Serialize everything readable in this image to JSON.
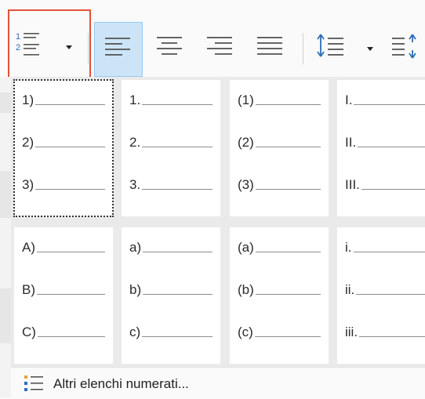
{
  "toolbar": {
    "buttons": [
      {
        "name": "numbering-button",
        "state": "highlighted"
      },
      {
        "name": "align-left-button",
        "state": "active"
      },
      {
        "name": "align-center-button"
      },
      {
        "name": "align-right-button"
      },
      {
        "name": "justify-button"
      },
      {
        "name": "line-spacing-button"
      },
      {
        "name": "paragraph-spacing-button"
      }
    ],
    "highlight_color": "#e0533a",
    "active_color": "#cce4f7"
  },
  "gallery": {
    "tiles": [
      {
        "id": "numbers-paren",
        "markers": [
          "1)",
          "2)",
          "3)"
        ],
        "selected": true
      },
      {
        "id": "numbers-dot",
        "markers": [
          "1.",
          "2.",
          "3."
        ]
      },
      {
        "id": "numbers-both-paren",
        "markers": [
          "(1)",
          "(2)",
          "(3)"
        ]
      },
      {
        "id": "roman-upper-dot",
        "markers": [
          "I.",
          "II.",
          "III."
        ]
      },
      {
        "id": "letters-upper-paren",
        "markers": [
          "A)",
          "B)",
          "C)"
        ]
      },
      {
        "id": "letters-lower-paren",
        "markers": [
          "a)",
          "b)",
          "c)"
        ]
      },
      {
        "id": "letters-lower-both-paren",
        "markers": [
          "(a)",
          "(b)",
          "(c)"
        ]
      },
      {
        "id": "roman-lower-dot",
        "markers": [
          "i.",
          "ii.",
          "iii."
        ]
      }
    ]
  },
  "footer": {
    "label": "Altri elenchi numerati...",
    "icon": "numbered-list-icon"
  }
}
